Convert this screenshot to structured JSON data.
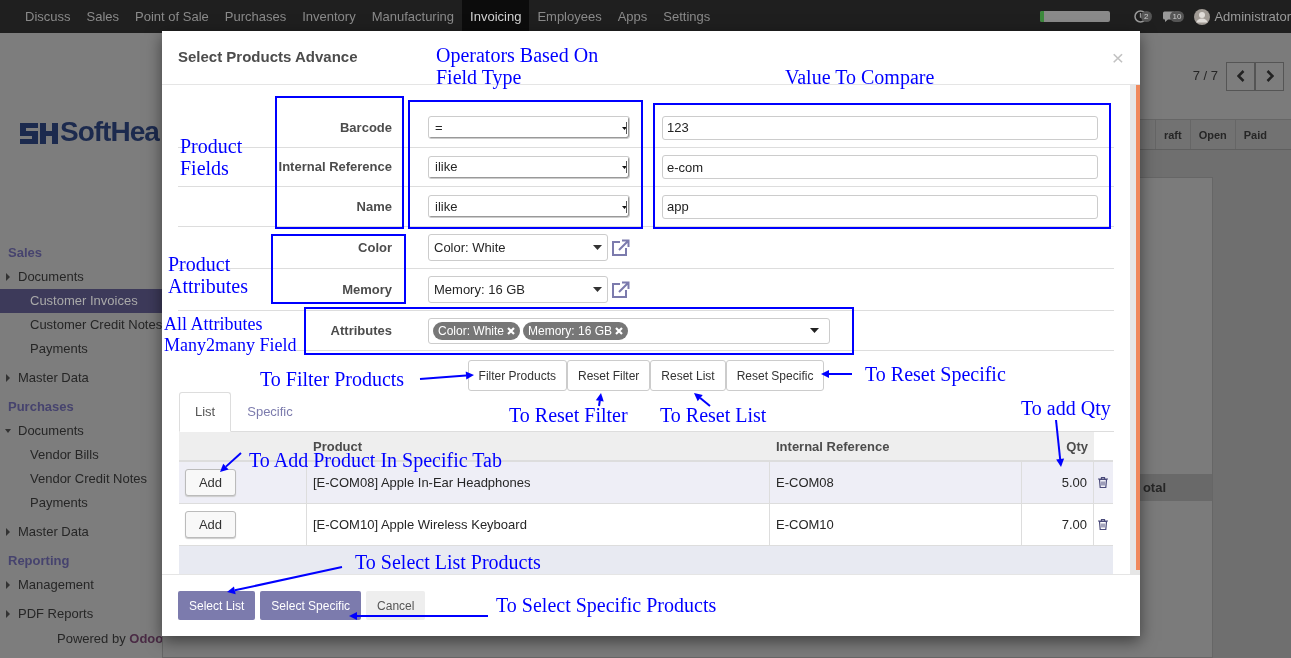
{
  "navbar": {
    "menus": [
      {
        "label": "Discuss",
        "selected": false
      },
      {
        "label": "Sales",
        "selected": false
      },
      {
        "label": "Point of Sale",
        "selected": false
      },
      {
        "label": "Purchases",
        "selected": false
      },
      {
        "label": "Inventory",
        "selected": false
      },
      {
        "label": "Manufacturing",
        "selected": false
      },
      {
        "label": "Invoicing",
        "selected": true
      },
      {
        "label": "Employees",
        "selected": false
      },
      {
        "label": "Apps",
        "selected": false
      },
      {
        "label": "Settings",
        "selected": false
      }
    ],
    "progress": {
      "level": 0.06
    },
    "activity_count": "2",
    "message_count": "10",
    "user": "Administrator"
  },
  "sidebar": {
    "logo_text": "SoftHea",
    "sections": [
      {
        "title": "Sales",
        "groups": [
          {
            "label": "Documents",
            "expanded": false,
            "children": [
              {
                "label": "Customer Invoices",
                "selected": true
              },
              {
                "label": "Customer Credit Notes",
                "selected": false
              },
              {
                "label": "Payments",
                "selected": false
              }
            ]
          },
          {
            "label": "Master Data",
            "expanded": false
          }
        ]
      },
      {
        "title": "Purchases",
        "groups": [
          {
            "label": "Documents",
            "expanded": true,
            "children": [
              {
                "label": "Vendor Bills",
                "selected": false
              },
              {
                "label": "Vendor Credit Notes",
                "selected": false
              },
              {
                "label": "Payments",
                "selected": false
              }
            ]
          },
          {
            "label": "Master Data",
            "expanded": false
          }
        ]
      },
      {
        "title": "Reporting",
        "groups": [
          {
            "label": "Management",
            "expanded": false
          },
          {
            "label": "PDF Reports",
            "expanded": false
          }
        ]
      }
    ],
    "footer": "Powered by **Odoo**"
  },
  "background": {
    "pager": "7 / 7",
    "status_steps": [
      "raft",
      "Open",
      "Paid"
    ],
    "column_fragment": "otal"
  },
  "dialog": {
    "title": "Select Products Advance",
    "close": "×",
    "field_filters": [
      {
        "label": "Barcode",
        "operator": "=",
        "value": "123"
      },
      {
        "label": "Internal Reference",
        "operator": "ilike",
        "value": "e-com"
      },
      {
        "label": "Name",
        "operator": "ilike",
        "value": "app"
      }
    ],
    "attribute_filters": [
      {
        "label": "Color",
        "value": "Color: White"
      },
      {
        "label": "Memory",
        "value": "Memory: 16 GB"
      }
    ],
    "attributes": {
      "label": "Attributes",
      "tags": [
        "Color: White",
        "Memory: 16 GB"
      ]
    },
    "actions": [
      "Filter Products",
      "Reset Filter",
      "Reset List",
      "Reset Specific"
    ],
    "tabs": [
      {
        "label": "List",
        "selected": true
      },
      {
        "label": "Specific",
        "selected": false
      }
    ],
    "table": {
      "columns": [
        "Product",
        "Internal Reference",
        "Qty"
      ],
      "rows": [
        {
          "button": "Add",
          "product": "[E-COM08] Apple In-Ear Headphones",
          "reference": "E-COM08",
          "qty": "5.00",
          "selected": true
        },
        {
          "button": "Add",
          "product": "[E-COM10] Apple Wireless Keyboard",
          "reference": "E-COM10",
          "qty": "7.00",
          "selected": false
        }
      ]
    },
    "footer_buttons": [
      {
        "label": "Select List",
        "kind": "primary"
      },
      {
        "label": "Select Specific",
        "kind": "primary"
      },
      {
        "label": "Cancel",
        "kind": "secondary"
      }
    ]
  },
  "annotations": [
    {
      "text": "Operators Based On\nField Type"
    },
    {
      "text": "Value To Compare"
    },
    {
      "text": "Product\nFields"
    },
    {
      "text": "Product\nAttributes"
    },
    {
      "text": "All Attributes\nMany2many Field"
    },
    {
      "text": "To Filter Products"
    },
    {
      "text": "To Reset Specific"
    },
    {
      "text": "To Reset Filter"
    },
    {
      "text": "To Reset List"
    },
    {
      "text": "To add Qty"
    },
    {
      "text": "To Add Product In Specific Tab"
    },
    {
      "text": "To Select List Products"
    },
    {
      "text": "To Select Specific Products"
    }
  ]
}
